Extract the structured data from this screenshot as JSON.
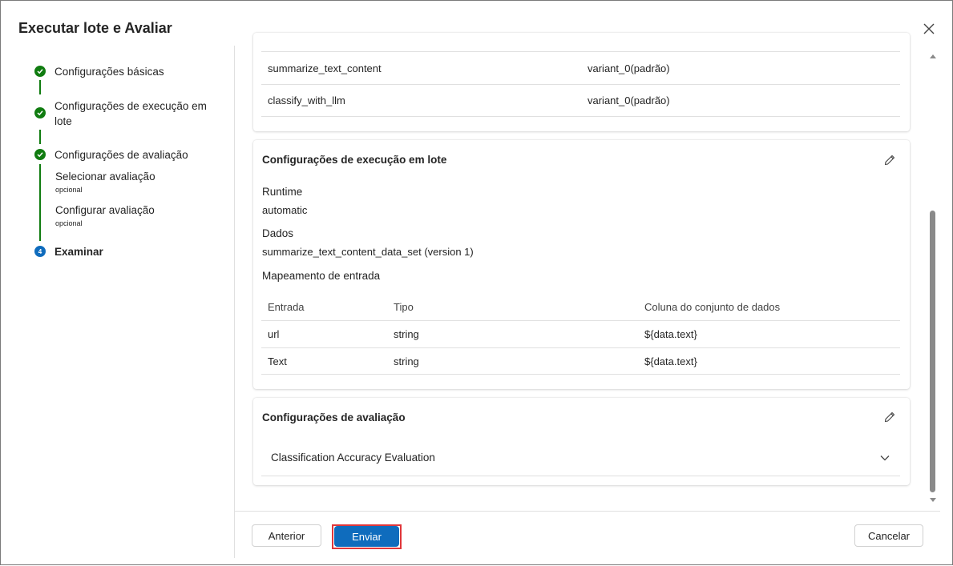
{
  "dialog": {
    "title": "Executar lote e Avaliar",
    "close_icon": "close-icon"
  },
  "stepper": {
    "steps": [
      {
        "label": "Configurações básicas",
        "status": "completed"
      },
      {
        "label": "Configurações de execução em lote",
        "status": "completed"
      },
      {
        "label": "Configurações de avaliação",
        "status": "completed"
      },
      {
        "label": "Examinar",
        "status": "current",
        "number": "4"
      }
    ],
    "substeps": [
      {
        "label": "Selecionar avaliação",
        "note": "opcional"
      },
      {
        "label": "Configurar avaliação",
        "note": "opcional"
      }
    ]
  },
  "variants_card": {
    "rows": [
      {
        "node": "summarize_text_content",
        "variant": "variant_0(padrão)"
      },
      {
        "node": "classify_with_llm",
        "variant": "variant_0(padrão)"
      }
    ]
  },
  "batch_card": {
    "title": "Configurações de execução em lote",
    "runtime_label": "Runtime",
    "runtime_value": "automatic",
    "data_label": "Dados",
    "data_value": "summarize_text_content_data_set (version 1)",
    "mapping_label": "Mapeamento de entrada",
    "columns": [
      "Entrada",
      "Tipo",
      "Coluna do conjunto de dados"
    ],
    "rows": [
      {
        "input": "url",
        "type": "string",
        "column": "${data.text}"
      },
      {
        "input": "Text",
        "type": "string",
        "column": "${data.text}"
      }
    ]
  },
  "eval_card": {
    "title": "Configurações de avaliação",
    "item": "Classification Accuracy Evaluation"
  },
  "footer": {
    "back_label": "Anterior",
    "submit_label": "Enviar",
    "cancel_label": "Cancelar"
  },
  "colors": {
    "accent": "#0f6cbd",
    "success": "#107c10",
    "highlight": "#e0363a"
  }
}
